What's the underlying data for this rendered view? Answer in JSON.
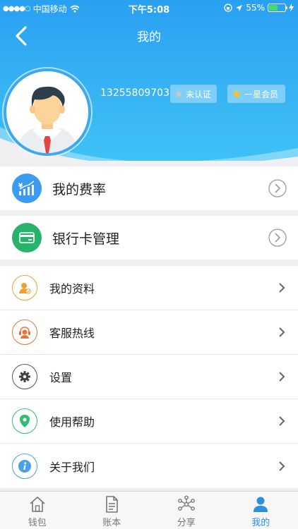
{
  "status_bar": {
    "carrier": "中国移动",
    "time": "下午5:08",
    "battery_percent": "55%",
    "battery_level": 0.55
  },
  "nav": {
    "back_icon": "chevron-left-icon",
    "title": "我的"
  },
  "profile": {
    "phone": "13255809703",
    "verify_badge": "未认证",
    "member_badge": "一星会员"
  },
  "cards": [
    {
      "label": "我的费率",
      "icon": "rate-chart-icon",
      "color": "#3a9bf0"
    },
    {
      "label": "银行卡管理",
      "icon": "bank-card-icon",
      "color": "#27b36b"
    }
  ],
  "menu": [
    {
      "label": "我的资料",
      "icon": "profile-icon",
      "color": "#f0a030"
    },
    {
      "label": "客服热线",
      "icon": "customer-service-icon",
      "color": "#e8743c"
    },
    {
      "label": "设置",
      "icon": "gear-icon",
      "color": "#555555"
    },
    {
      "label": "使用帮助",
      "icon": "help-pin-icon",
      "color": "#2fbf74"
    },
    {
      "label": "关于我们",
      "icon": "info-icon",
      "color": "#4a9fe8"
    }
  ],
  "tabbar": [
    {
      "label": "钱包",
      "icon": "home-icon",
      "active": false
    },
    {
      "label": "账本",
      "icon": "document-icon",
      "active": false
    },
    {
      "label": "分享",
      "icon": "share-icon",
      "active": false
    },
    {
      "label": "我的",
      "icon": "user-icon",
      "active": true
    }
  ],
  "colors": {
    "header_blue": "#2aa0f2",
    "active_tab": "#2a8fe0"
  }
}
